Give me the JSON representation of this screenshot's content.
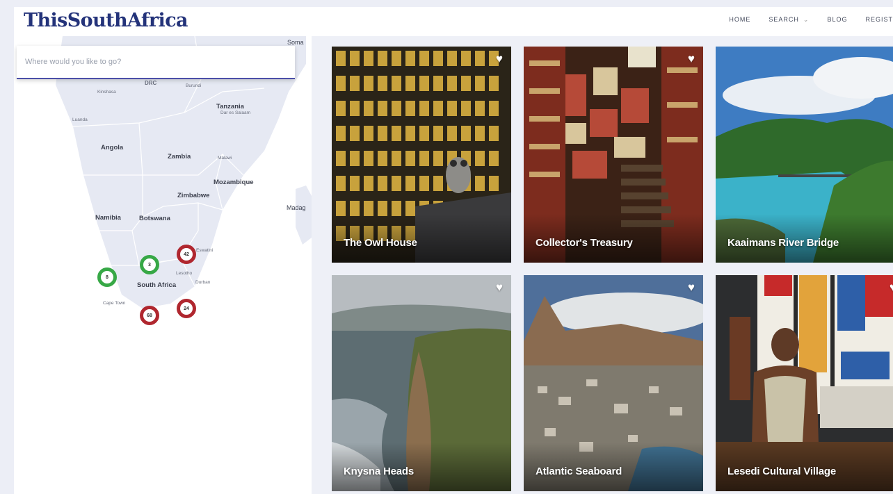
{
  "header": {
    "logo": "ThisSouthAfrica",
    "nav": [
      {
        "label": "HOME"
      },
      {
        "label": "SEARCH",
        "has_dropdown": true
      },
      {
        "label": "BLOG"
      },
      {
        "label": "REGIST"
      }
    ]
  },
  "search": {
    "placeholder": "Where would you like to go?"
  },
  "map": {
    "labels": {
      "somalia": "Soma",
      "drc": "DRC",
      "burundi": "Burundi",
      "kinshasa": "Kinshasa",
      "tanzania": "Tanzania",
      "dar_es_salaam": "Dar es Salaam",
      "luanda": "Luanda",
      "angola": "Angola",
      "zambia": "Zambia",
      "malawi": "Malawi",
      "mozambique": "Mozambique",
      "zimbabwe": "Zimbabwe",
      "madagascar": "Madag",
      "namibia": "Namibia",
      "botswana": "Botswana",
      "eswatini": "Eswatini",
      "lesotho": "Lesotho",
      "durban": "Durban",
      "south_africa": "South Africa",
      "cape_town": "Cape Town"
    },
    "clusters": [
      {
        "count": "8",
        "color": "green"
      },
      {
        "count": "3",
        "color": "green"
      },
      {
        "count": "42",
        "color": "red"
      },
      {
        "count": "24",
        "color": "red"
      },
      {
        "count": "68",
        "color": "red"
      }
    ]
  },
  "cards": [
    {
      "title": "The Owl House",
      "icon": "heart-icon"
    },
    {
      "title": "Collector's Treasury",
      "icon": "heart-icon"
    },
    {
      "title": "Kaaimans River Bridge",
      "icon": "heart-icon"
    },
    {
      "title": "Knysna Heads",
      "icon": "heart-icon"
    },
    {
      "title": "Atlantic Seaboard",
      "icon": "heart-icon"
    },
    {
      "title": "Lesedi Cultural Village",
      "icon": "heart-icon"
    }
  ],
  "colors": {
    "brand": "#24337a",
    "search_accent": "#4b4fa8",
    "cluster_green": "#37a846",
    "cluster_red": "#b0272f"
  }
}
